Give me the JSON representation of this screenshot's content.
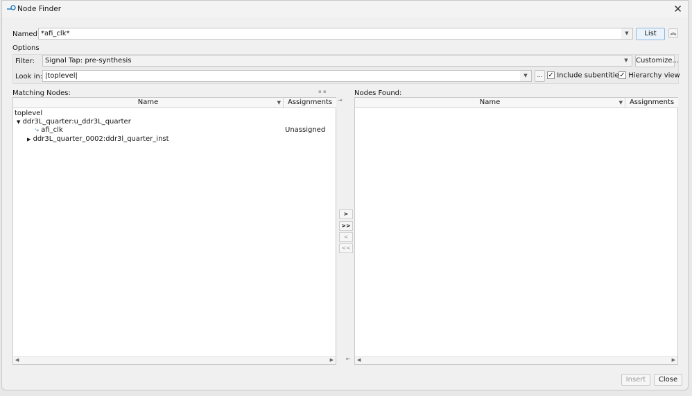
{
  "window": {
    "title": "Node Finder"
  },
  "named": {
    "label": "Named:",
    "value": "*afi_clk*",
    "list_button": "List"
  },
  "options": {
    "label": "Options",
    "filter_label": "Filter:",
    "filter_value": "Signal Tap: pre-synthesis",
    "customize_button": "Customize...",
    "lookin_label": "Look in:",
    "lookin_value": "|toplevel|",
    "browse_button": "...",
    "include_subentities": "Include subentities",
    "hierarchy_view": "Hierarchy view"
  },
  "matching": {
    "label": "Matching Nodes:",
    "col_name": "Name",
    "col_assign": "Assignments",
    "rows": [
      {
        "name": "toplevel",
        "assign": ""
      },
      {
        "name": "ddr3L_quarter:u_ddr3L_quarter",
        "assign": ""
      },
      {
        "name": "afi_clk",
        "assign": "Unassigned"
      },
      {
        "name": "ddr3L_quarter_0002:ddr3l_quarter_inst",
        "assign": ""
      }
    ]
  },
  "found": {
    "label": "Nodes Found:",
    "col_name": "Name",
    "col_assign": "Assignments"
  },
  "transfer": {
    "add": ">",
    "add_all": ">>",
    "remove": "<",
    "remove_all": "<<"
  },
  "footer": {
    "insert": "Insert",
    "close": "Close"
  }
}
